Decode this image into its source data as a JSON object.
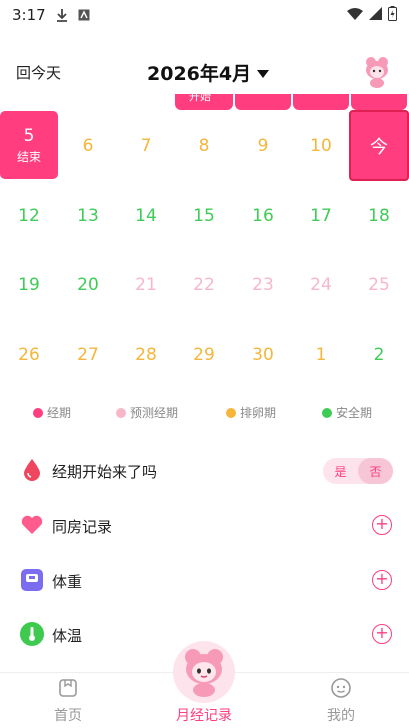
{
  "status_bar": {
    "time": "3:17"
  },
  "header": {
    "back_today": "回今天",
    "month_title": "2026年4月"
  },
  "strip": {
    "label": "开始"
  },
  "calendar": {
    "rows": [
      [
        {
          "day": "5",
          "sub": "结束",
          "state": "period"
        },
        {
          "day": "6",
          "state": "yellow"
        },
        {
          "day": "7",
          "state": "yellow"
        },
        {
          "day": "8",
          "state": "yellow"
        },
        {
          "day": "9",
          "state": "yellow"
        },
        {
          "day": "10",
          "state": "yellow"
        },
        {
          "day": "今",
          "state": "today"
        }
      ],
      [
        {
          "day": "12",
          "state": "green"
        },
        {
          "day": "13",
          "state": "green"
        },
        {
          "day": "14",
          "state": "green"
        },
        {
          "day": "15",
          "state": "green"
        },
        {
          "day": "16",
          "state": "green"
        },
        {
          "day": "17",
          "state": "green"
        },
        {
          "day": "18",
          "state": "green"
        }
      ],
      [
        {
          "day": "19",
          "state": "green"
        },
        {
          "day": "20",
          "state": "green"
        },
        {
          "day": "21",
          "state": "pink"
        },
        {
          "day": "22",
          "state": "pink"
        },
        {
          "day": "23",
          "state": "pink"
        },
        {
          "day": "24",
          "state": "pink"
        },
        {
          "day": "25",
          "state": "pink"
        }
      ],
      [
        {
          "day": "26",
          "state": "yellow"
        },
        {
          "day": "27",
          "state": "yellow"
        },
        {
          "day": "28",
          "state": "yellow"
        },
        {
          "day": "29",
          "state": "yellow"
        },
        {
          "day": "30",
          "state": "yellow"
        },
        {
          "day": "1",
          "state": "yellow"
        },
        {
          "day": "2",
          "state": "green"
        }
      ]
    ]
  },
  "legend": [
    {
      "label": "经期",
      "color": "#ff3d7f"
    },
    {
      "label": "预测经期",
      "color": "#f7b7c9"
    },
    {
      "label": "排卵期",
      "color": "#f5b63a"
    },
    {
      "label": "安全期",
      "color": "#3fcc56"
    }
  ],
  "records": {
    "period_start": {
      "label": "经期开始来了吗",
      "yes": "是",
      "no": "否",
      "selected": "否"
    },
    "intimacy": {
      "label": "同房记录",
      "icon": "heart-icon"
    },
    "weight": {
      "label": "体重",
      "icon": "scale-icon"
    },
    "temperature": {
      "label": "体温",
      "icon": "thermometer-icon"
    }
  },
  "bottom_nav": {
    "home": "首页",
    "period": "月经记录",
    "mine": "我的"
  },
  "colors": {
    "accent": "#ff3d7f",
    "green": "#3fcc56",
    "yellow": "#f5b63a",
    "light_pink": "#f7b7c9"
  }
}
